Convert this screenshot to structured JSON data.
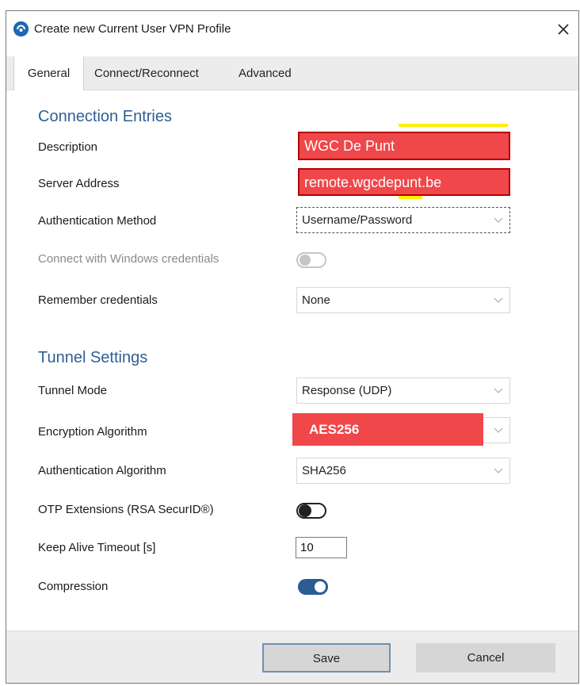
{
  "window": {
    "title": "Create new Current User VPN Profile",
    "icons": {
      "app": "vpn-client-icon",
      "close": "close-icon"
    }
  },
  "tabs": [
    {
      "label": "General",
      "active": true
    },
    {
      "label": "Connect/Reconnect",
      "active": false
    },
    {
      "label": "Advanced",
      "active": false
    }
  ],
  "connection": {
    "section_title": "Connection Entries",
    "description_label": "Description",
    "description_value": "WGC De Punt",
    "server_label": "Server Address",
    "server_value": "remote.wgcdepunt.be",
    "auth_method_label": "Authentication Method",
    "auth_method_value": "Username/Password",
    "windows_creds_label": "Connect with Windows credentials",
    "windows_creds_enabled": false,
    "remember_label": "Remember credentials",
    "remember_value": "None"
  },
  "tunnel": {
    "section_title": "Tunnel Settings",
    "mode_label": "Tunnel Mode",
    "mode_value": "Response (UDP)",
    "encryption_label": "Encryption Algorithm",
    "encryption_value": "AES256",
    "auth_algo_label": "Authentication Algorithm",
    "auth_algo_value": "SHA256",
    "otp_label": "OTP Extensions (RSA SecurID®)",
    "otp_enabled": false,
    "keepalive_label": "Keep Alive Timeout [s]",
    "keepalive_value": "10",
    "compression_label": "Compression",
    "compression_enabled": true
  },
  "footer": {
    "save_label": "Save",
    "cancel_label": "Cancel"
  },
  "colors": {
    "accent": "#2f5f96",
    "redaction": "#f0474a",
    "toggle_on": "#2d5c94"
  }
}
